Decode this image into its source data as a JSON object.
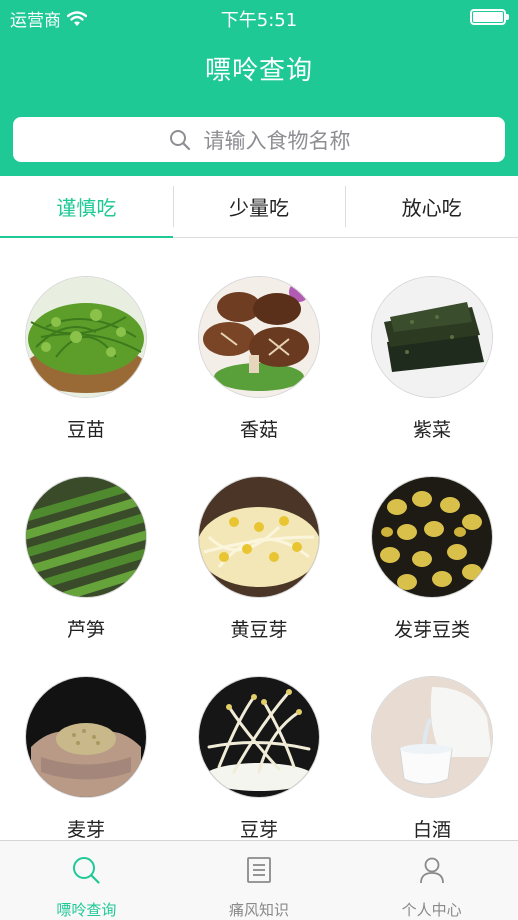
{
  "status_bar": {
    "carrier": "运营商",
    "time": "下午5:51"
  },
  "nav": {
    "title": "嘌呤查询"
  },
  "search": {
    "placeholder": "请输入食物名称"
  },
  "tabs": [
    {
      "label": "谨慎吃",
      "active": true
    },
    {
      "label": "少量吃",
      "active": false
    },
    {
      "label": "放心吃",
      "active": false
    }
  ],
  "foods": [
    {
      "name": "豆苗"
    },
    {
      "name": "香菇"
    },
    {
      "name": "紫菜"
    },
    {
      "name": "芦笋"
    },
    {
      "name": "黄豆芽"
    },
    {
      "name": "发芽豆类"
    },
    {
      "name": "麦芽"
    },
    {
      "name": "豆芽"
    },
    {
      "name": "白酒"
    }
  ],
  "tab_bar": [
    {
      "label": "嘌呤查询",
      "icon": "search-icon",
      "active": true
    },
    {
      "label": "痛风知识",
      "icon": "list-icon",
      "active": false
    },
    {
      "label": "个人中心",
      "icon": "person-icon",
      "active": false
    }
  ],
  "colors": {
    "accent": "#1ec996",
    "inactive": "#8a8a8a"
  }
}
